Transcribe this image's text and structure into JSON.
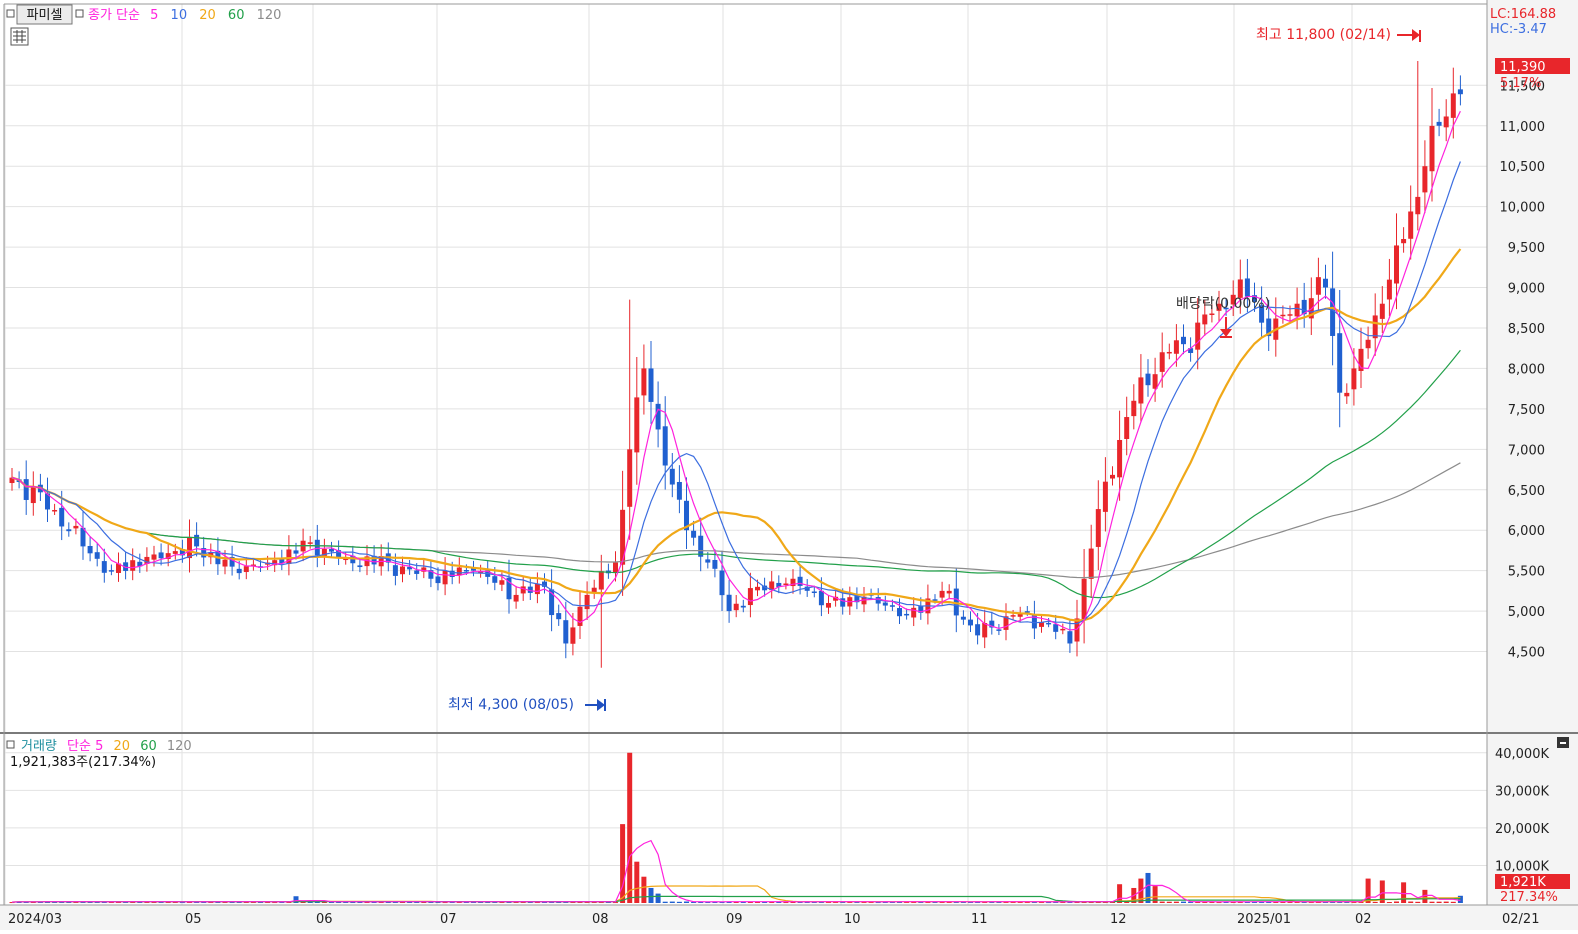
{
  "colors": {
    "up": "#e8262b",
    "down": "#2060d0",
    "ma5": "#ff22dd",
    "ma10": "#3c6ee0",
    "ma20": "#f0a818",
    "ma60": "#22a04a",
    "ma120": "#8c8c8c",
    "label_dark": "#333333",
    "grid": "#e2e2e2",
    "axis_bg": "#f4f4f4"
  },
  "price_panel": {
    "title_button": "파미셀",
    "legend": {
      "label": "종가 단순",
      "p5": "5",
      "p10": "10",
      "p20": "20",
      "p60": "60",
      "p120": "120"
    },
    "lc_text": "LC:164.88",
    "hc_text": "HC:-3.47",
    "last_price_text": "11,390",
    "last_change_text": "5.17%",
    "high_annotation": "최고 11,800 (02/14)",
    "low_annotation": "최저 4,300 (08/05)",
    "dividend_annotation": "배당락(0.00%)"
  },
  "volume_panel": {
    "legend": {
      "label": "거래량",
      "ma_label": "단순 5",
      "p20": "20",
      "p60": "60",
      "p120": "120"
    },
    "info_text": "1,921,383주(217.34%)",
    "last_volume_text": "1,921K",
    "last_volume_pct_text": "217.34%"
  },
  "chart_data": {
    "type": "candlestick",
    "period": "daily",
    "x_axis_labels": [
      "2024/03",
      "05",
      "06",
      "07",
      "08",
      "09",
      "10",
      "11",
      "12",
      "2025/01",
      "02",
      "02/21"
    ],
    "price_ticks": [
      4500,
      5000,
      5500,
      6000,
      6500,
      7000,
      7500,
      8000,
      8500,
      9000,
      9500,
      10000,
      10500,
      11000,
      11500
    ],
    "price_tick_labels": [
      "4,500",
      "5,000",
      "5,500",
      "6,000",
      "6,500",
      "7,000",
      "7,500",
      "8,000",
      "8,500",
      "9,000",
      "9,500",
      "10,000",
      "10,500",
      "11,000",
      "11,500"
    ],
    "price_range": [
      4000,
      11850
    ],
    "volume_ticks": [
      10000,
      20000,
      30000,
      40000
    ],
    "volume_tick_labels": [
      "10,000K",
      "20,000K",
      "30,000K",
      "40,000K"
    ],
    "volume_range": [
      0,
      41000
    ],
    "price_anchors": [
      [
        0,
        6650
      ],
      [
        6,
        6250
      ],
      [
        10,
        5800
      ],
      [
        14,
        5500
      ],
      [
        20,
        5700
      ],
      [
        26,
        5800
      ],
      [
        31,
        5550
      ],
      [
        36,
        5600
      ],
      [
        42,
        5850
      ],
      [
        47,
        5650
      ],
      [
        53,
        5600
      ],
      [
        59,
        5400
      ],
      [
        65,
        5500
      ],
      [
        71,
        5200
      ],
      [
        75,
        5300
      ],
      [
        78,
        4600
      ],
      [
        81,
        5200
      ],
      [
        85,
        5600
      ],
      [
        87,
        7000
      ],
      [
        89,
        8000
      ],
      [
        92,
        6800
      ],
      [
        95,
        6000
      ],
      [
        98,
        5600
      ],
      [
        101,
        5000
      ],
      [
        105,
        5300
      ],
      [
        110,
        5400
      ],
      [
        115,
        5100
      ],
      [
        121,
        5200
      ],
      [
        126,
        4950
      ],
      [
        131,
        5250
      ],
      [
        136,
        4700
      ],
      [
        141,
        4950
      ],
      [
        146,
        4850
      ],
      [
        149,
        4600
      ],
      [
        151,
        5400
      ],
      [
        154,
        6600
      ],
      [
        158,
        7600
      ],
      [
        162,
        8200
      ],
      [
        165,
        8300
      ],
      [
        170,
        8800
      ],
      [
        173,
        9100
      ],
      [
        177,
        8400
      ],
      [
        181,
        8800
      ],
      [
        185,
        9000
      ],
      [
        187,
        7700
      ],
      [
        189,
        8000
      ],
      [
        193,
        8800
      ],
      [
        196,
        9600
      ],
      [
        199,
        10500
      ],
      [
        201,
        11000
      ],
      [
        203,
        11400
      ],
      [
        204,
        11390
      ]
    ],
    "volume_spikes": [
      {
        "index": 40,
        "volume": 1800
      },
      {
        "index": 86,
        "volume": 21000
      },
      {
        "index": 87,
        "volume": 40000
      },
      {
        "index": 88,
        "volume": 11000
      },
      {
        "index": 89,
        "volume": 7000
      },
      {
        "index": 90,
        "volume": 4000
      },
      {
        "index": 91,
        "volume": 2500
      },
      {
        "index": 156,
        "volume": 5000
      },
      {
        "index": 158,
        "volume": 4000
      },
      {
        "index": 159,
        "volume": 6500
      },
      {
        "index": 160,
        "volume": 8000
      },
      {
        "index": 161,
        "volume": 4500
      },
      {
        "index": 191,
        "volume": 6500
      },
      {
        "index": 193,
        "volume": 6000
      },
      {
        "index": 196,
        "volume": 5500
      },
      {
        "index": 199,
        "volume": 3500
      }
    ],
    "last": {
      "close": 11390,
      "change_pct": 5.17,
      "volume": 1921383,
      "volume_pct": 217.34
    },
    "high": {
      "value": 11800,
      "date": "02/14"
    },
    "low": {
      "value": 4300,
      "date": "08/05"
    }
  }
}
